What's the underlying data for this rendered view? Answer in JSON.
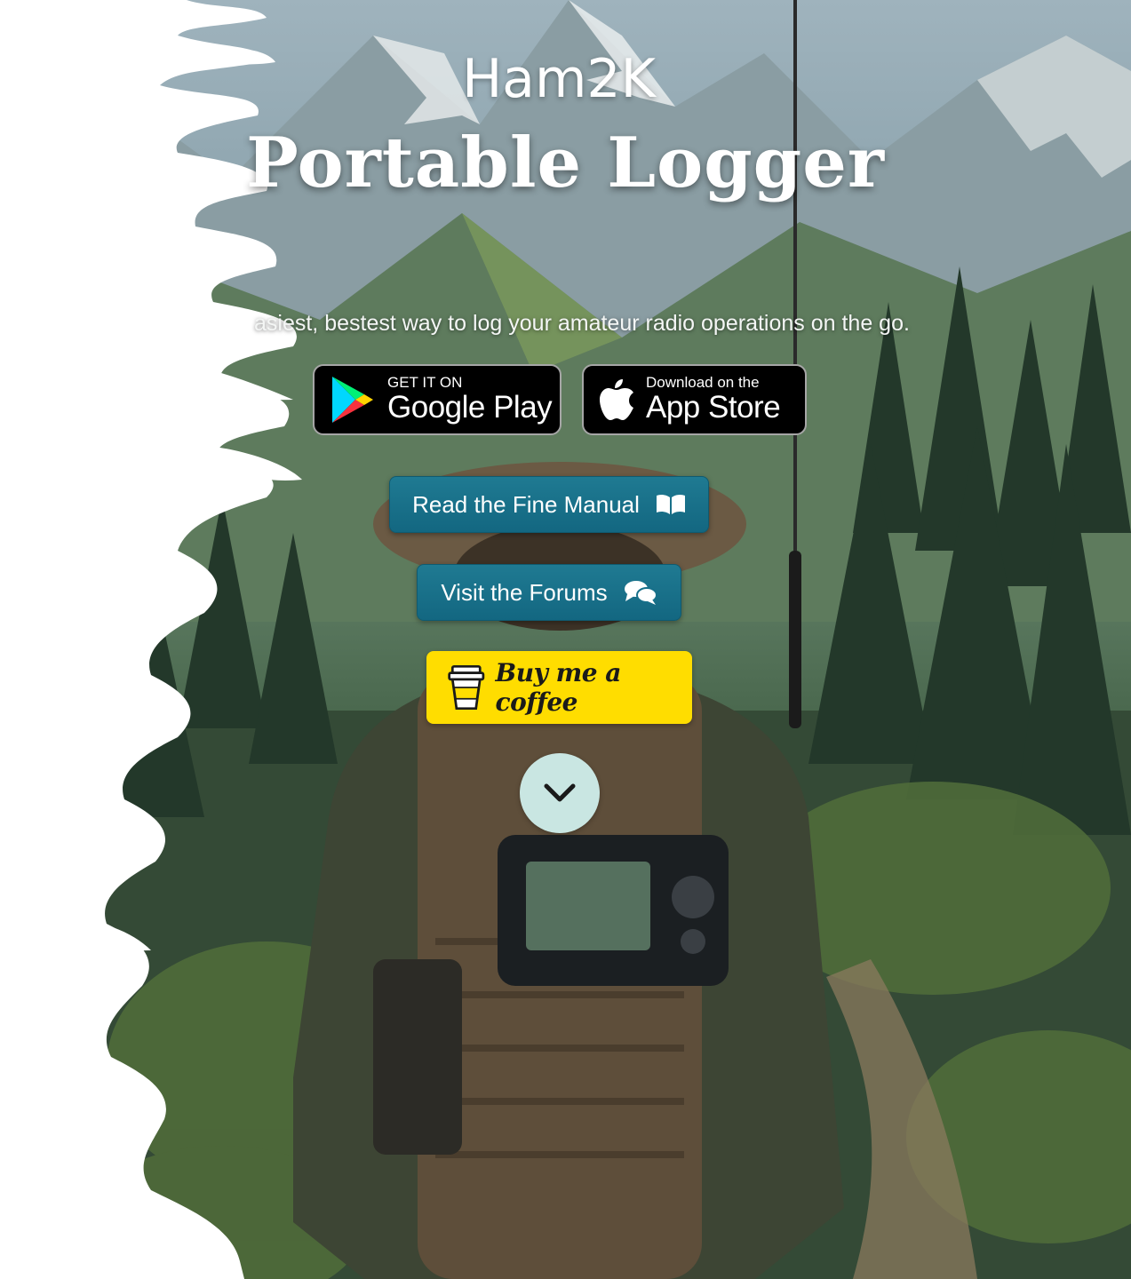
{
  "hero": {
    "brand": "Ham2K",
    "title": "Portable Logger",
    "tagline": "asiest, bestest way to log your amateur radio operations on the go."
  },
  "stores": {
    "google": {
      "small": "GET IT ON",
      "large": "Google Play"
    },
    "apple": {
      "small": "Download on the",
      "large": "App Store"
    }
  },
  "buttons": {
    "manual": "Read the Fine Manual",
    "forums": "Visit the Forums",
    "coffee": "Buy me a coffee"
  },
  "icons": {
    "manual": "book-open-icon",
    "forums": "comments-icon",
    "coffee": "coffee-cup-icon",
    "scroll": "chevron-down-icon",
    "google": "google-play-icon",
    "apple": "apple-icon"
  },
  "colors": {
    "teal_button": "#17708a",
    "coffee_yellow": "#ffdd00",
    "scroll_circle": "#c9e6e2"
  }
}
